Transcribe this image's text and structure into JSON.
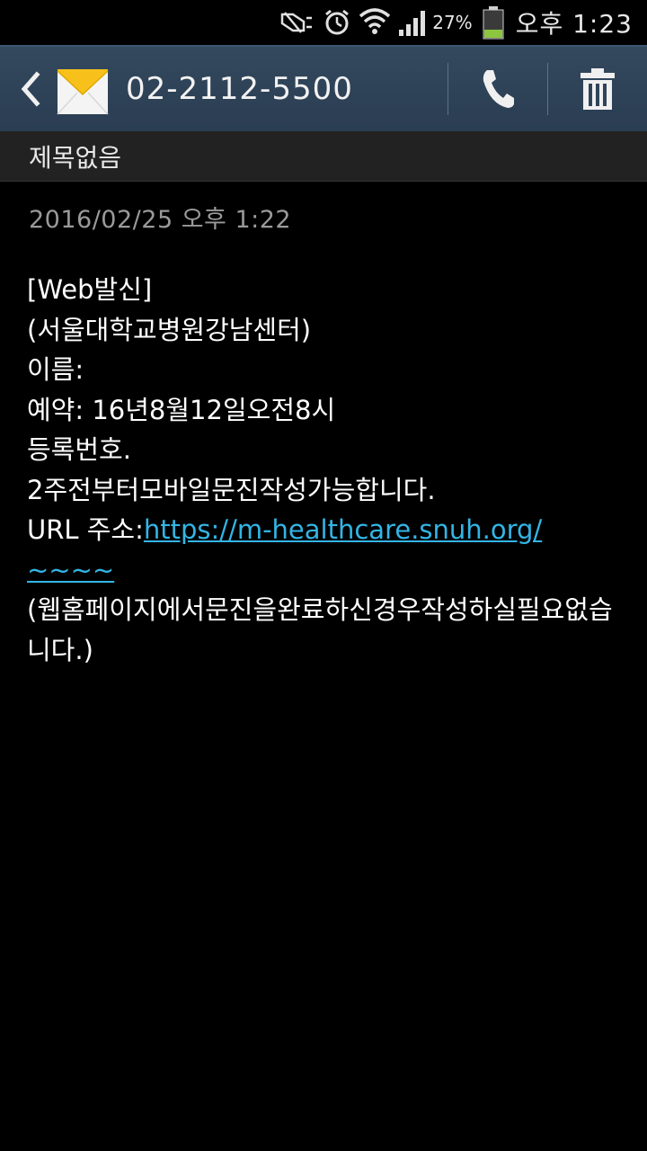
{
  "status_bar": {
    "battery_percent": "27%",
    "time": "오후 1:23",
    "icons": [
      "mute-icon",
      "alarm-icon",
      "wifi-icon",
      "signal-icon",
      "battery-icon"
    ]
  },
  "action_bar": {
    "contact_number": "02-2112-5500",
    "icons": [
      "back-icon",
      "envelope-icon",
      "phone-icon",
      "trash-icon"
    ]
  },
  "subject": "제목없음",
  "message": {
    "date": "2016/02/25  오후 1:22",
    "lines": {
      "l1": "[Web발신]",
      "l2": "(서울대학교병원강남센터)",
      "l3": "이름:",
      "l4": "예약: 16년8월12일오전8시",
      "l5": "등록번호.",
      "l6": "2주전부터모바일문진작성가능합니다.",
      "l7_prefix": "URL 주소:",
      "l7_link": "https://m-healthcare.snuh.org/",
      "l8_link": "~~~~",
      "l9": "(웹홈페이지에서문진을완료하신경우작성하실필요없습니다.)"
    }
  },
  "colors": {
    "action_bar": "#2f4458",
    "link": "#33b5e5",
    "battery_fill": "#8cc63f"
  }
}
